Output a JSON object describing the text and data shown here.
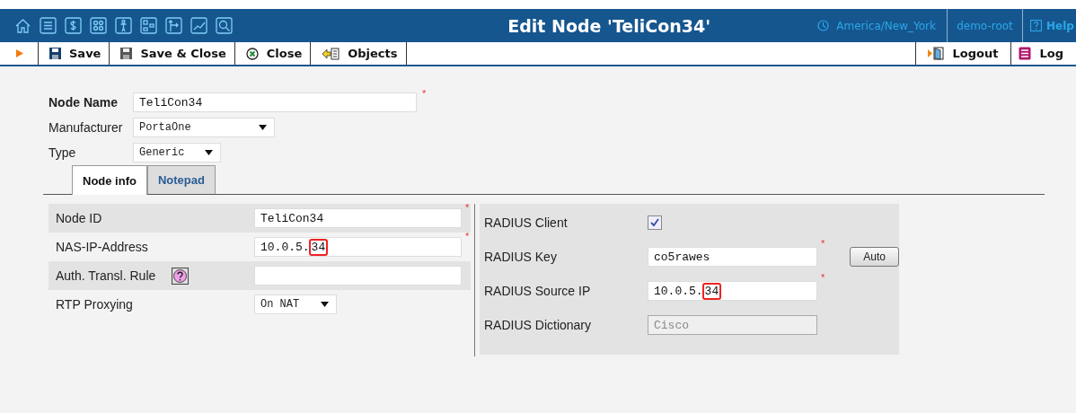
{
  "top_bar": {
    "title": "Edit Node 'TeliCon34'",
    "timezone": "America/New_York",
    "user": "demo-root",
    "help": "Help"
  },
  "toolbar": {
    "buttons": [
      {
        "label": "Save"
      },
      {
        "label": "Save & Close"
      },
      {
        "label": "Close"
      },
      {
        "label": "Objects"
      }
    ],
    "right_buttons": [
      {
        "label": "Logout"
      },
      {
        "label": "Log"
      }
    ]
  },
  "header_fields": [
    {
      "kind": "text",
      "label": "Node Name",
      "value": "TeliCon34",
      "required_mark": "*"
    },
    {
      "kind": "select",
      "label": "Manufacturer",
      "value": "PortaOne"
    },
    {
      "kind": "select",
      "label": "Type",
      "value": "Generic"
    }
  ],
  "tabs": [
    {
      "label": "Node info",
      "selected": true
    },
    {
      "label": "Notepad",
      "selected": false
    }
  ],
  "left_rows": [
    {
      "kind": "text",
      "label": "Node ID",
      "value": "TeliCon34",
      "required_mark": "*"
    },
    {
      "kind": "text",
      "label": "NAS-IP-Address",
      "value": "10.0.5.",
      "marked": "34",
      "required_mark": "*"
    },
    {
      "kind": "help",
      "label": "Auth. Transl. Rule"
    },
    {
      "kind": "select",
      "label": "RTP Proxying",
      "value": "On NAT"
    }
  ],
  "right_rows": [
    {
      "kind": "checkbox",
      "label": "RADIUS Client",
      "checked": true
    },
    {
      "kind": "text",
      "label": "RADIUS Key",
      "value": "co5rawes",
      "required_mark": "*",
      "button": "Auto"
    },
    {
      "kind": "text",
      "label": "RADIUS Source IP",
      "value": "10.0.5.",
      "marked": "34",
      "required_mark": "*"
    },
    {
      "kind": "disabled",
      "label": "RADIUS Dictionary",
      "value": "Cisco"
    }
  ]
}
